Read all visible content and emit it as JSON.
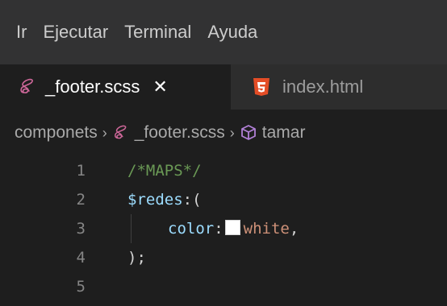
{
  "menubar": {
    "items": [
      "Ir",
      "Ejecutar",
      "Terminal",
      "Ayuda"
    ]
  },
  "tabs": [
    {
      "label": "_footer.scss",
      "icon": "sass-icon",
      "active": true,
      "close": "✕"
    },
    {
      "label": "index.html",
      "icon": "html5-icon",
      "active": false
    }
  ],
  "breadcrumb": {
    "folder": "componets",
    "file": "_footer.scss",
    "symbol": "tamar"
  },
  "editor": {
    "lines": [
      {
        "number": "1",
        "comment": "/*MAPS*/"
      },
      {
        "number": "2",
        "variable": "$redes",
        "punct": ":("
      },
      {
        "number": "3",
        "property": "color",
        "colon": ":",
        "value": "white",
        "trailing": ","
      },
      {
        "number": "4",
        "closing": ");"
      },
      {
        "number": "5"
      }
    ]
  },
  "colors": {
    "sass": "#cd6799",
    "html5": "#e44d26",
    "cube": "#b180d7",
    "swatch": "#ffffff"
  }
}
